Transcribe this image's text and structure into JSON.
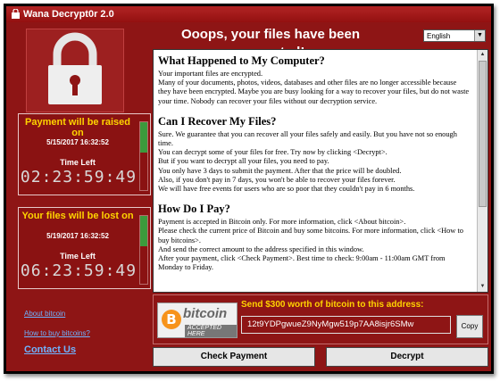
{
  "window": {
    "title": "Wana Decrypt0r 2.0",
    "heading": "Ooops, your files have been encrypted!",
    "language": "English"
  },
  "timers": [
    {
      "label": "Payment will be raised on",
      "date": "5/15/2017 16:32:52",
      "time_left_label": "Time Left",
      "countdown": "02:23:59:49"
    },
    {
      "label": "Your files will be lost on",
      "date": "5/19/2017 16:32:52",
      "time_left_label": "Time Left",
      "countdown": "06:23:59:49"
    }
  ],
  "content": {
    "sections": [
      {
        "title": "What Happened to My Computer?",
        "paragraphs": [
          "Your important files are encrypted.\nMany of your documents, photos, videos, databases and other files are no longer accessible because they have been encrypted. Maybe you are busy looking for a way to recover your files, but do not waste your time. Nobody can recover your files without our decryption service."
        ]
      },
      {
        "title": "Can I Recover My Files?",
        "paragraphs": [
          "Sure. We guarantee that you can recover all your files safely and easily. But you have not so enough time.\nYou can decrypt some of your files for free. Try now by clicking <Decrypt>.\nBut if you want to decrypt all your files, you need to pay.\nYou only have 3 days to submit the payment. After that the price will be doubled.\nAlso, if you don't pay in 7 days, you won't be able to recover your files forever.\nWe will have free events for users who are so poor that they couldn't pay in 6 months."
        ]
      },
      {
        "title": "How Do I Pay?",
        "paragraphs": [
          "Payment is accepted in Bitcoin only. For more information, click <About bitcoin>.\nPlease check the current price of Bitcoin and buy some bitcoins. For more information, click <How to buy bitcoins>.\nAnd send the correct amount to the address specified in this window.\nAfter your payment, click <Check Payment>. Best time to check: 9:00am - 11:00am GMT from Monday to Friday."
        ]
      }
    ]
  },
  "links": {
    "about_bitcoin": "About bitcoin",
    "how_to_buy": "How to buy bitcoins?",
    "contact_us": "Contact Us"
  },
  "payment": {
    "logo_word": "bitcoin",
    "logo_symbol": "B",
    "logo_tagline": "ACCEPTED HERE",
    "send_label": "Send $300 worth of bitcoin to this address:",
    "address": "12t9YDPgwueZ9NyMgw519p7AA8isjr6SMw",
    "copy_label": "Copy"
  },
  "buttons": {
    "check_payment": "Check Payment",
    "decrypt": "Decrypt"
  },
  "colors": {
    "window_bg": "#8e1515",
    "accent_yellow": "#ffd400",
    "link_blue": "#6fb3ff"
  }
}
